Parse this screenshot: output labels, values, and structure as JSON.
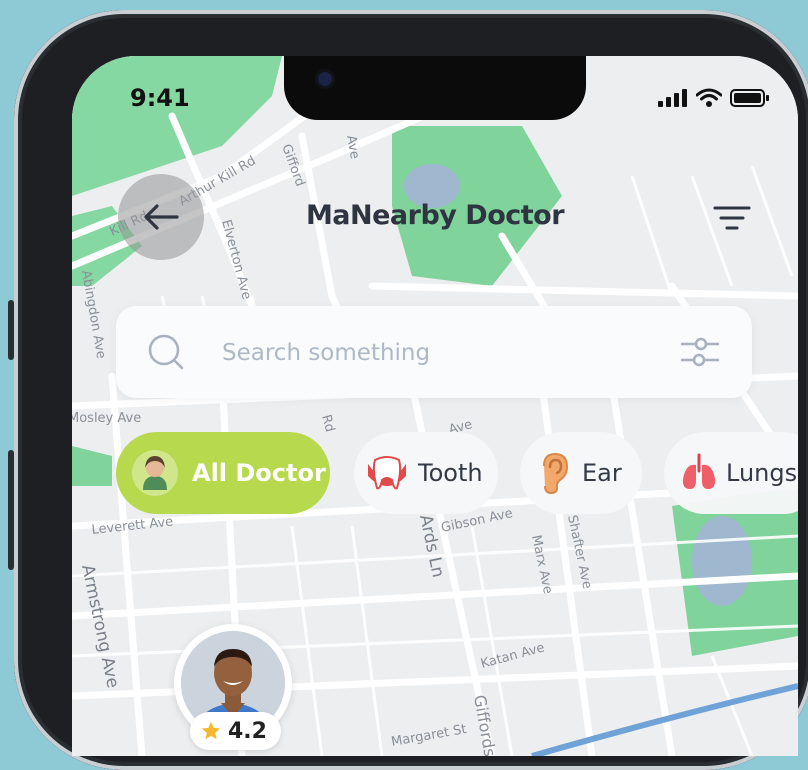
{
  "status": {
    "time": "9:41"
  },
  "header": {
    "title": "MaNearby Doctor"
  },
  "search": {
    "placeholder": "Search something"
  },
  "categories": [
    {
      "label": "All Doctor",
      "icon": "doctor-avatar-icon",
      "active": true
    },
    {
      "label": "Tooth",
      "icon": "tooth-icon",
      "active": false
    },
    {
      "label": "Ear",
      "icon": "ear-icon",
      "active": false
    },
    {
      "label": "Lungs",
      "icon": "lungs-icon",
      "active": false
    }
  ],
  "doctor_pin": {
    "rating": "4.2",
    "icon": "star-icon"
  },
  "map": {
    "street_labels": [
      "Arthur Kill Rd",
      "Kill Rd",
      "Gifford",
      "Ave",
      "Elverton Ave",
      "Abingdon Ave",
      "Mosley Ave",
      "Rd",
      "Ave",
      "Gibson Ave",
      "Leverett Ave",
      "Ards Ln",
      "Marx Ave",
      "Shafter Ave",
      "Armstrong Ave",
      "Katan Ave",
      "Giffords",
      "Margaret St"
    ]
  },
  "colors": {
    "accent": "#b7d94e",
    "park": "#7fd39b",
    "water": "#9fb8cf",
    "road": "#ffffff",
    "bezel": "#1d1f22",
    "background": "#8ec9d6"
  }
}
